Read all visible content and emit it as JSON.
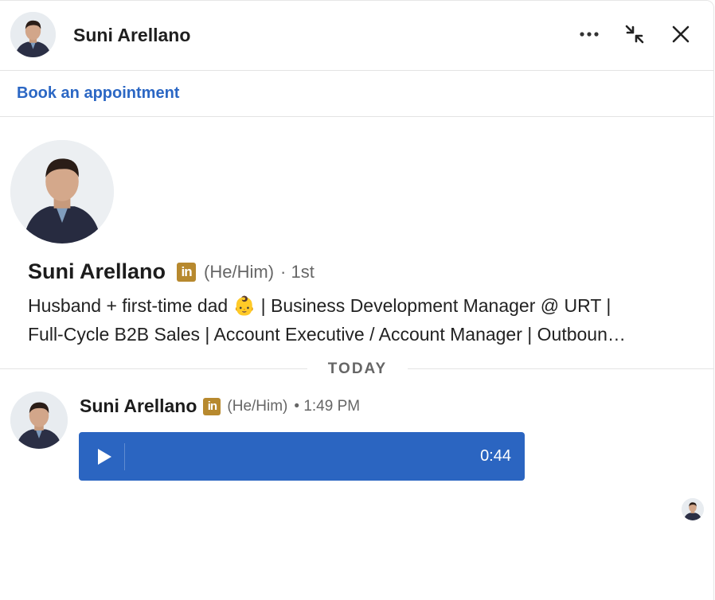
{
  "header": {
    "name": "Suni Arellano",
    "more_icon": "more-horizontal-icon",
    "minimize_icon": "minimize-arrows-icon",
    "close_icon": "close-icon"
  },
  "appointment": {
    "label": "Book an appointment"
  },
  "profile": {
    "name": "Suni Arellano",
    "badge": "in",
    "pronouns": "(He/Him)",
    "degree": "· 1st",
    "headline_line1": "Husband + first-time dad 👶 | Business Development Manager @ URT |",
    "headline_line2": "Full-Cycle B2B Sales | Account Executive / Account Manager | Outboun…"
  },
  "divider": {
    "label": "TODAY"
  },
  "message": {
    "sender": "Suni Arellano",
    "badge": "in",
    "pronouns": "(He/Him)",
    "time": "• 1:49 PM",
    "audio_duration": "0:44",
    "audio_color": "#2b65c1"
  },
  "colors": {
    "link": "#2b67c4",
    "badge": "#b7892e"
  }
}
